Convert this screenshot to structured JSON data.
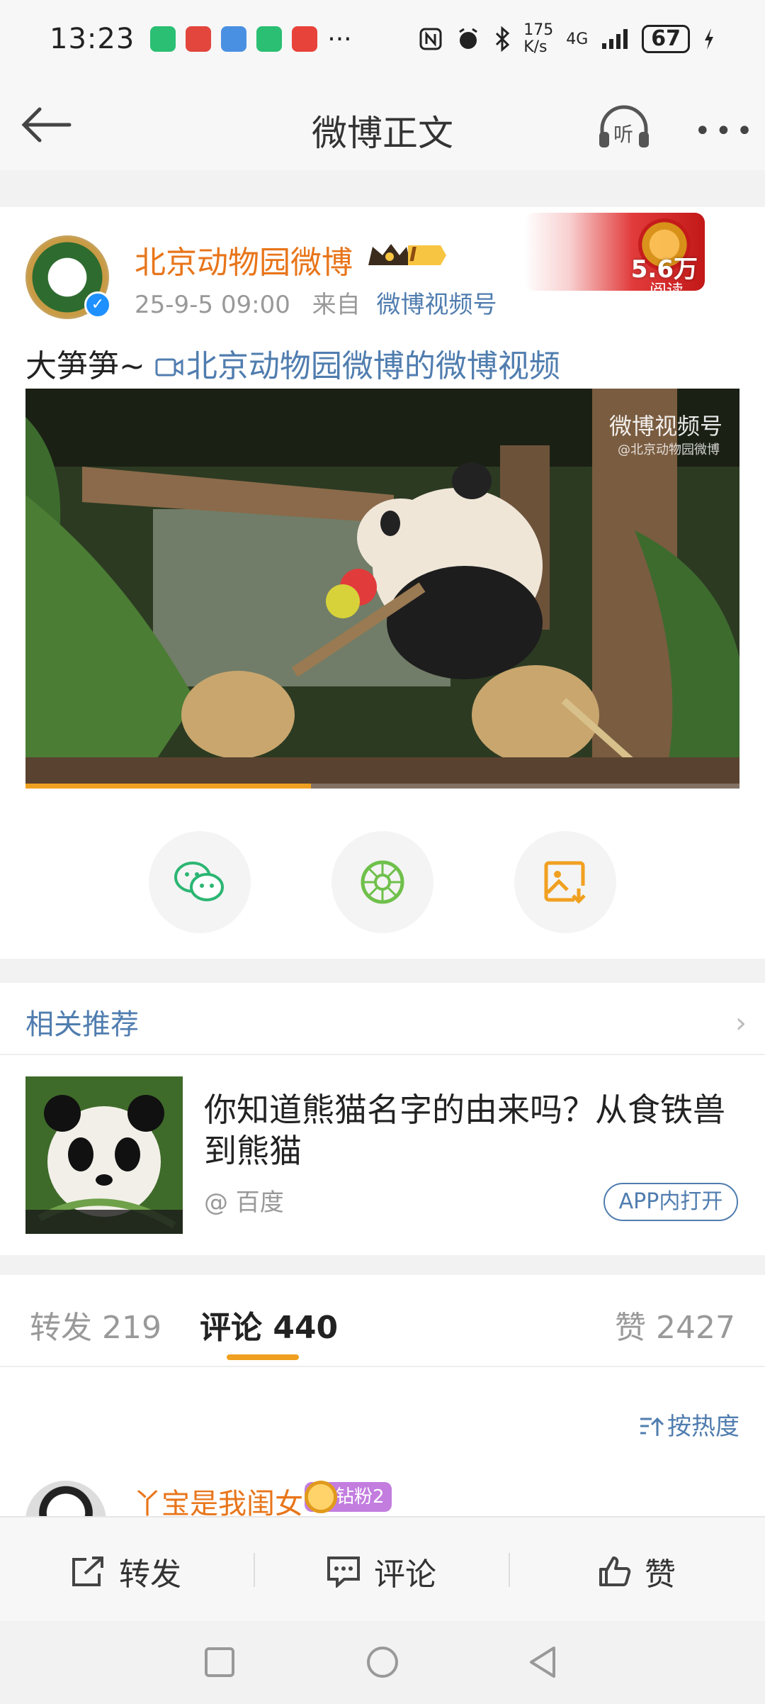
{
  "status_bar": {
    "time": "13:23",
    "net_speed_top": "175",
    "net_speed_bottom": "K/s",
    "signal": "4G",
    "battery": "67",
    "overflow": "···"
  },
  "nav": {
    "title": "微博正文",
    "listen_label": "听"
  },
  "post": {
    "author": "北京动物园微博",
    "vip_level": "I",
    "date": "25-9-5 09:00",
    "source_prefix": "来自",
    "source": "微博视频号",
    "read_count": "5.6万",
    "read_label": "阅读",
    "text": "大笋笋~",
    "video_link": "北京动物园微博的微博视频",
    "video_watermark": "微博视频号",
    "video_watermark_sub": "@北京动物园微博",
    "video_progress": 0.4
  },
  "related": {
    "header": "相关推荐",
    "title": "你知道熊猫名字的由来吗？从食铁兽到熊猫",
    "source": "@ 百度",
    "open_button": "APP内打开"
  },
  "tabs": {
    "repost": "转发 219",
    "comment": "评论 440",
    "like": "赞 2427"
  },
  "comments": {
    "sort_label": "按热度",
    "first": {
      "name": "丫宝是我闺女",
      "badge": "钻粉2"
    }
  },
  "bottom": {
    "repost": "转发",
    "comment": "评论",
    "like": "赞"
  },
  "colors": {
    "accent_orange": "#f0a020",
    "link_blue": "#507daf",
    "author_orange": "#e8751a"
  }
}
